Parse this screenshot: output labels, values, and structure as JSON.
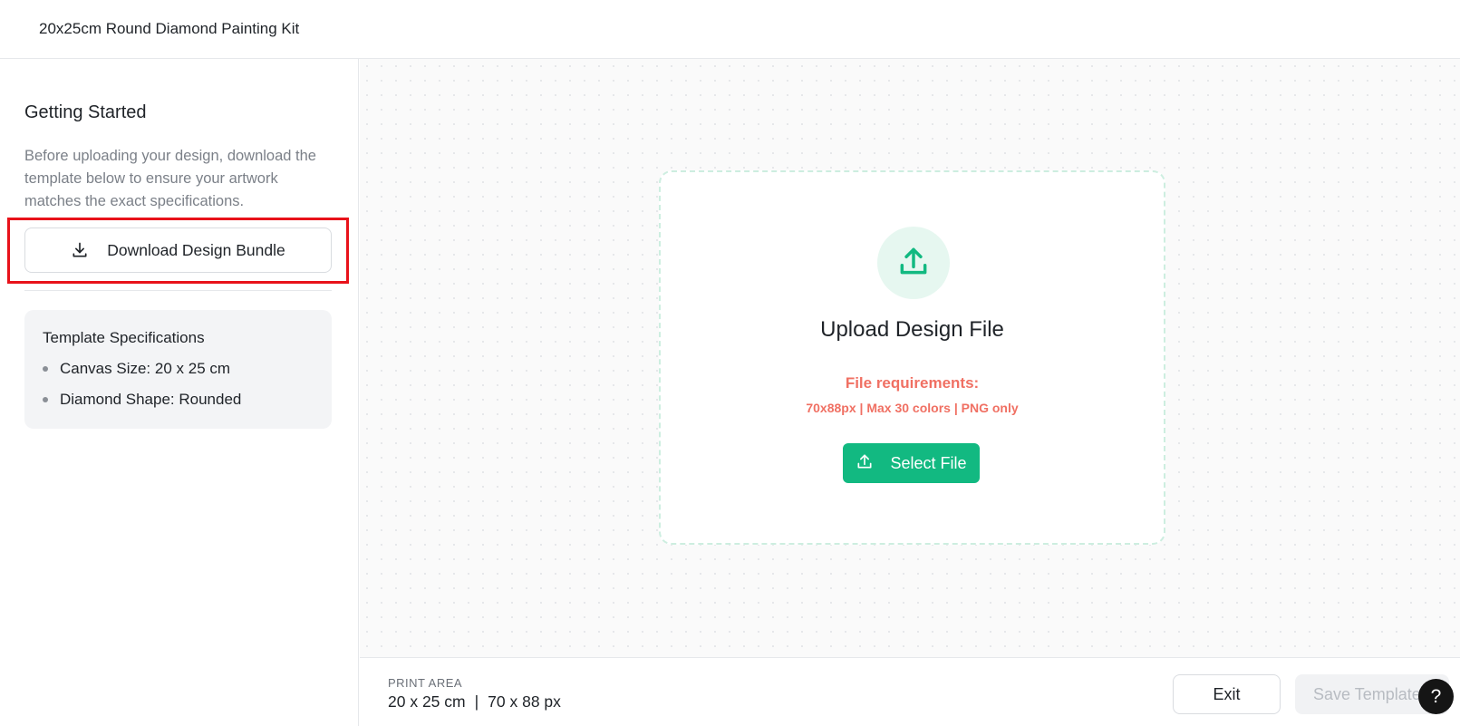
{
  "header": {
    "title": "20x25cm Round Diamond Painting Kit"
  },
  "sidebar": {
    "title": "Getting Started",
    "description": "Before uploading your design, download the template below to ensure your artwork matches the exact specifications.",
    "download_button": {
      "label": "Download Design Bundle",
      "icon": "download-icon"
    },
    "specs": {
      "title": "Template Specifications",
      "items": [
        {
          "label": "Canvas Size: 20 x 25 cm"
        },
        {
          "label": "Diamond Shape: Rounded"
        }
      ]
    }
  },
  "upload": {
    "icon": "upload-icon",
    "title": "Upload Design File",
    "requirements_label": "File requirements:",
    "requirements_detail": "70x88px | Max 30 colors | PNG only",
    "select_button": {
      "label": "Select File",
      "icon": "upload-icon"
    }
  },
  "footer": {
    "print_area_label": "PRINT AREA",
    "print_area_cm": "20 x 25 cm",
    "separator": "|",
    "print_area_px": "70 x 88 px",
    "exit_label": "Exit",
    "save_label": "Save Template"
  },
  "help": {
    "label": "?"
  },
  "colors": {
    "accent": "#12b981",
    "accent_light": "#e6f7f0",
    "requirement_text": "#f07063",
    "highlight": "#e8121a"
  }
}
